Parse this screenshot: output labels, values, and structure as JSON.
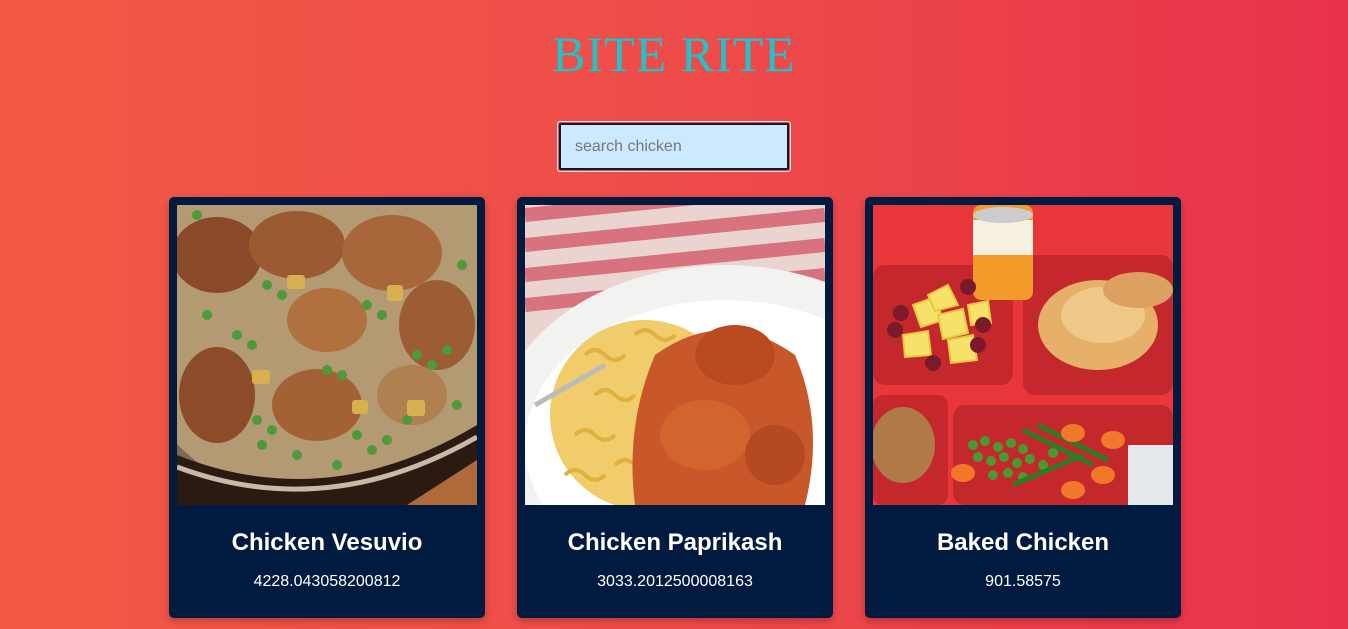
{
  "header": {
    "title": "BITE RITE",
    "title_color": "#1fc3c9"
  },
  "search": {
    "placeholder": "search chicken",
    "value": ""
  },
  "recipes": [
    {
      "title": "Chicken Vesuvio",
      "calories": "4228.043058200812",
      "image": "chicken-vesuvio-photo"
    },
    {
      "title": "Chicken Paprikash",
      "calories": "3033.2012500008163",
      "image": "chicken-paprikash-photo"
    },
    {
      "title": "Baked Chicken",
      "calories": "901.58575",
      "image": "baked-chicken-photo"
    }
  ],
  "colors": {
    "card_background": "#011a40",
    "search_background": "#cde9ff",
    "page_gradient_start": "#f25a45",
    "page_gradient_end": "#e8324a"
  }
}
